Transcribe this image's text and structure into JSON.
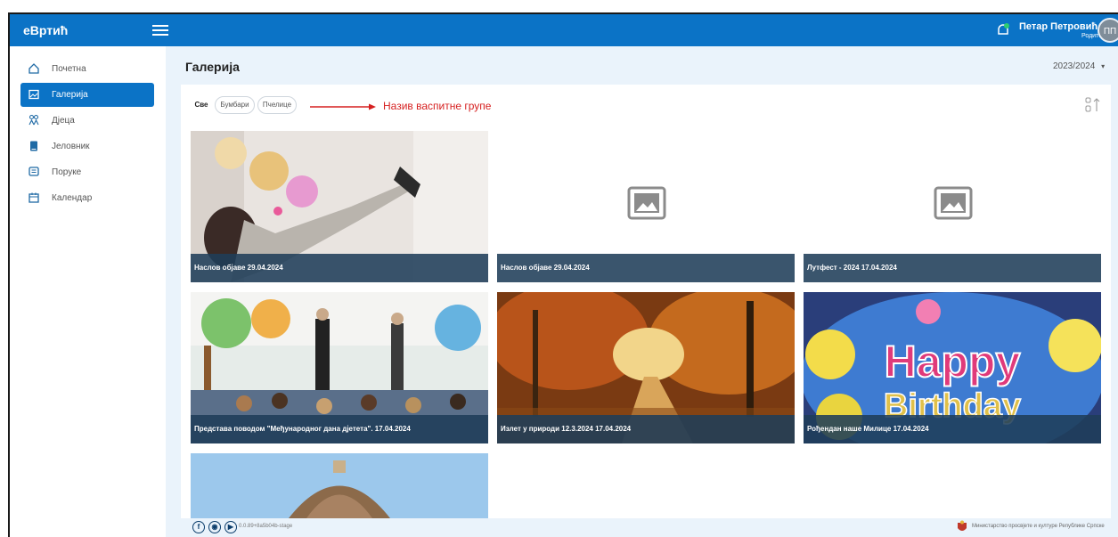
{
  "app": {
    "logo": "eВртић"
  },
  "user": {
    "name": "Петар Петровић",
    "role": "Родитељ",
    "initials": "ПП"
  },
  "sidebar": {
    "items": [
      {
        "label": "Почетна",
        "icon": "home-icon",
        "active": false
      },
      {
        "label": "Галерија",
        "icon": "gallery-icon",
        "active": true
      },
      {
        "label": "Дјеца",
        "icon": "children-icon",
        "active": false
      },
      {
        "label": "Јеловник",
        "icon": "menu-book-icon",
        "active": false
      },
      {
        "label": "Поруке",
        "icon": "messages-icon",
        "active": false
      },
      {
        "label": "Календар",
        "icon": "calendar-icon",
        "active": false
      }
    ]
  },
  "main": {
    "title": "Галерија",
    "year": "2023/2024",
    "filters": [
      {
        "label": "Све",
        "active": true
      },
      {
        "label": "Бумбари",
        "active": false
      },
      {
        "label": "Пчелице",
        "active": false
      }
    ],
    "annotation": "Назив васпитне групе"
  },
  "gallery": [
    {
      "caption": "Наслов објаве 29.04.2024",
      "image": "woman-balloons-photo"
    },
    {
      "caption": "Наслов објаве 29.04.2024",
      "image": "placeholder-icon"
    },
    {
      "caption": "Лутфест - 2024 17.04.2024",
      "image": "placeholder-icon"
    },
    {
      "caption": "Представа поводом \"Међународног дана дјетета\". 17.04.2024",
      "image": "theater-show-photo"
    },
    {
      "caption": "Излет у природи 12.3.2024 17.04.2024",
      "image": "autumn-forest-photo"
    },
    {
      "caption": "Рођендан наше Милице 17.04.2024",
      "image": "happy-birthday-photo"
    },
    {
      "caption": "",
      "image": "cathedral-dome-photo"
    }
  ],
  "footer": {
    "version": "0.0.89+8a5b04b-stage",
    "ministry": "Министарство просвјете и културе Републике Српске"
  },
  "colors": {
    "primary": "#0b73c6",
    "caption_bg": "#1f3d59",
    "annotation": "#d62020"
  }
}
